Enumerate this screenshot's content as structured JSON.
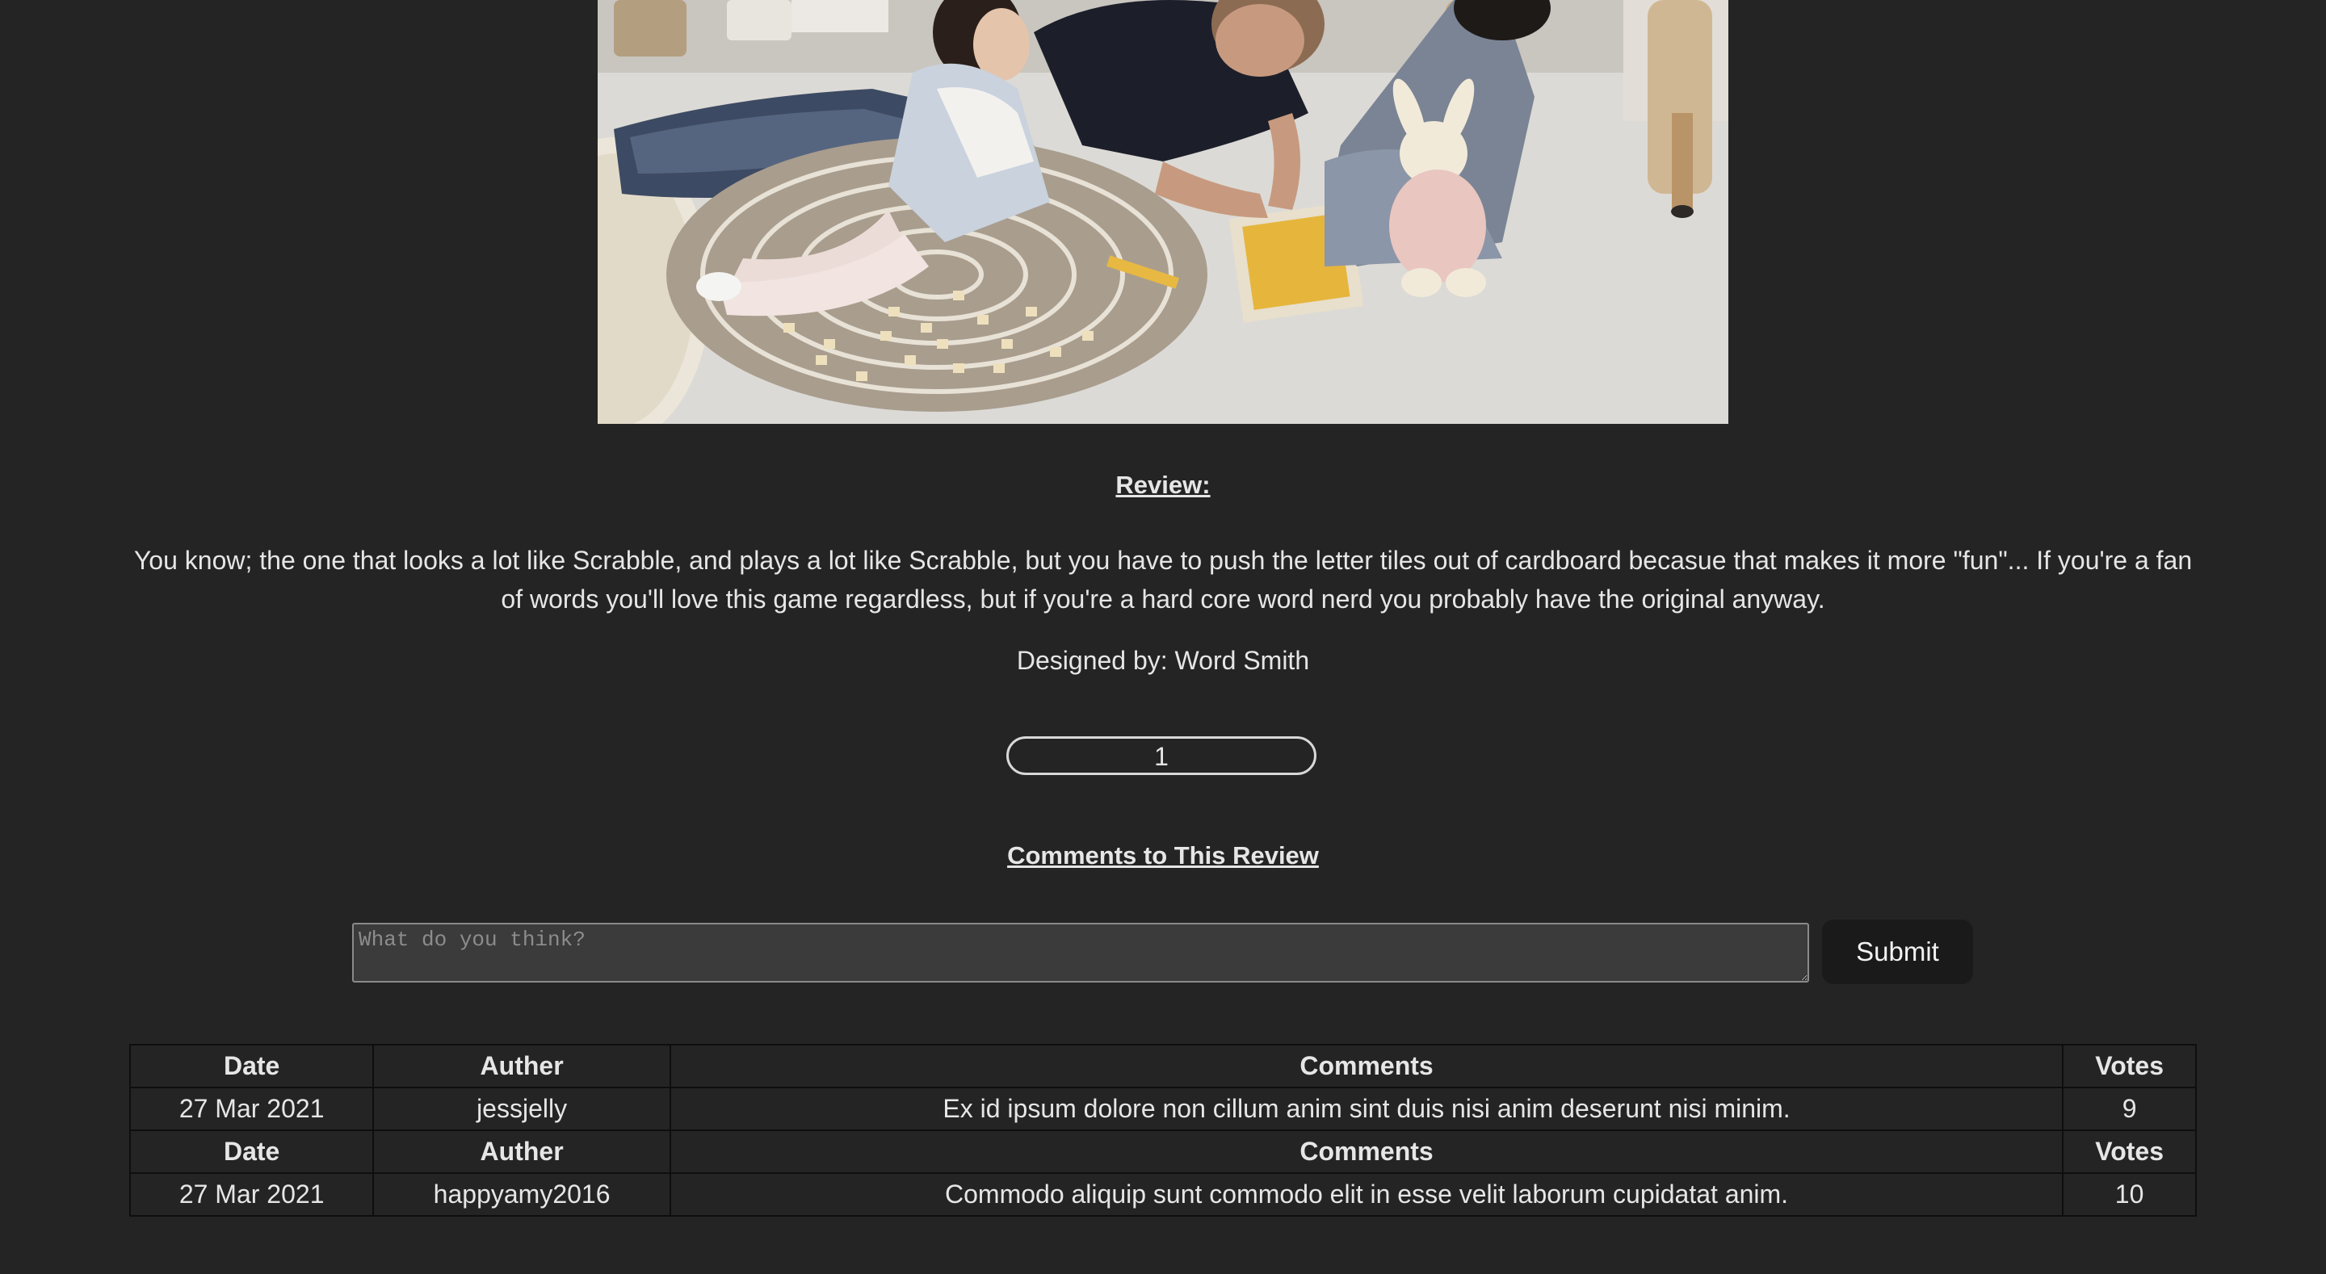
{
  "photo": {
    "alt_icon": "family-playing-board-game-image"
  },
  "review": {
    "heading": "Review:",
    "body": "You know; the one that looks a lot like Scrabble, and plays a lot like Scrabble, but you have to push the letter tiles out of cardboard becasue that makes it more \"fun\"... If you're a fan of words you'll love this game regardless, but if you're a hard core word nerd you probably have the original anyway.",
    "designer": "Designed by: Word Smith",
    "votes": "1"
  },
  "comments": {
    "heading": "Comments to This Review",
    "input_placeholder": "What do you think?",
    "input_value": "",
    "submit_label": "Submit",
    "rows": [
      {
        "headers": {
          "date": "Date",
          "author": "Auther",
          "comments": "Comments",
          "votes": "Votes"
        },
        "date": "27 Mar 2021",
        "author": "jessjelly",
        "comment": "Ex id ipsum dolore non cillum anim sint duis nisi anim deserunt nisi minim.",
        "votes": "9"
      },
      {
        "headers": {
          "date": "Date",
          "author": "Auther",
          "comments": "Comments",
          "votes": "Votes"
        },
        "date": "27 Mar 2021",
        "author": "happyamy2016",
        "comment": "Commodo aliquip sunt commodo elit in esse velit laborum cupidatat anim.",
        "votes": "10"
      }
    ]
  },
  "colors": {
    "background": "#242424",
    "text": "#e6e6e6",
    "input_bg": "#3b3b3b",
    "button_bg": "#1a1a1a"
  }
}
